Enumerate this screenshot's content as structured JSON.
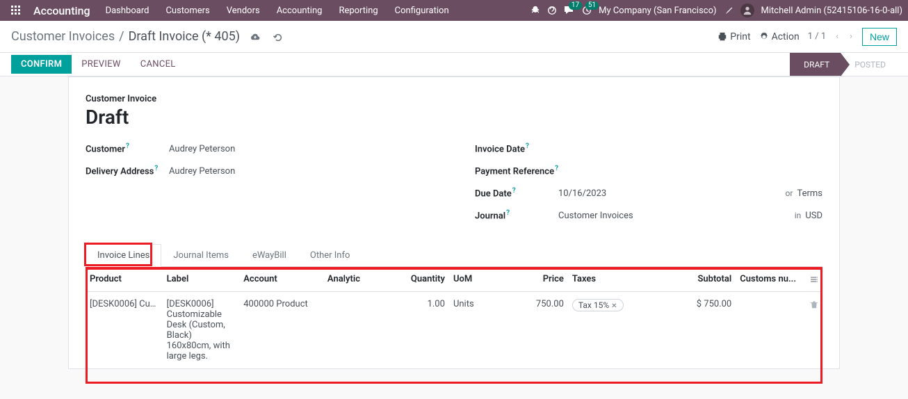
{
  "topnav": {
    "app_name": "Accounting",
    "menus": [
      "Dashboard",
      "Customers",
      "Vendors",
      "Accounting",
      "Reporting",
      "Configuration"
    ],
    "msg_badge": "17",
    "activity_badge": "51",
    "company": "My Company (San Francisco)",
    "user": "Mitchell Admin (52415106-16-0-all)"
  },
  "controlbar": {
    "crumb_root": "Customer Invoices",
    "crumb_current": "Draft Invoice (* 405)",
    "print": "Print",
    "action": "Action",
    "pager": "1 / 1",
    "new_btn": "New"
  },
  "statusbar": {
    "confirm": "Confirm",
    "preview": "Preview",
    "cancel": "Cancel",
    "draft": "DRAFT",
    "posted": "POSTED"
  },
  "sheet": {
    "subtype": "Customer Invoice",
    "title": "Draft",
    "left": {
      "customer_label": "Customer",
      "customer": "Audrey Peterson",
      "delivery_label": "Delivery Address",
      "delivery": "Audrey Peterson"
    },
    "right": {
      "invdate_label": "Invoice Date",
      "invdate": "",
      "payref_label": "Payment Reference",
      "payref": "",
      "duedate_label": "Due Date",
      "duedate": "10/16/2023",
      "due_or": "or",
      "due_terms": "Terms",
      "journal_label": "Journal",
      "journal": "Customer Invoices",
      "journal_in": "in",
      "journal_cur": "USD"
    }
  },
  "tabs": {
    "items": [
      "Invoice Lines",
      "Journal Items",
      "eWayBill",
      "Other Info"
    ],
    "active": 0
  },
  "table": {
    "headers": {
      "product": "Product",
      "label": "Label",
      "account": "Account",
      "analytic": "Analytic",
      "quantity": "Quantity",
      "uom": "UoM",
      "price": "Price",
      "taxes": "Taxes",
      "subtotal": "Subtotal",
      "customs": "Customs nu..."
    },
    "row": {
      "product": "[DESK0006] Cus",
      "label": "[DESK0006] Customizable Desk (Custom, Black) 160x80cm, with large legs.",
      "account": "400000 Product",
      "analytic": "",
      "quantity": "1.00",
      "uom": "Units",
      "price": "750.00",
      "tax": "Tax 15%",
      "subtotal": "$ 750.00",
      "customs": ""
    }
  }
}
